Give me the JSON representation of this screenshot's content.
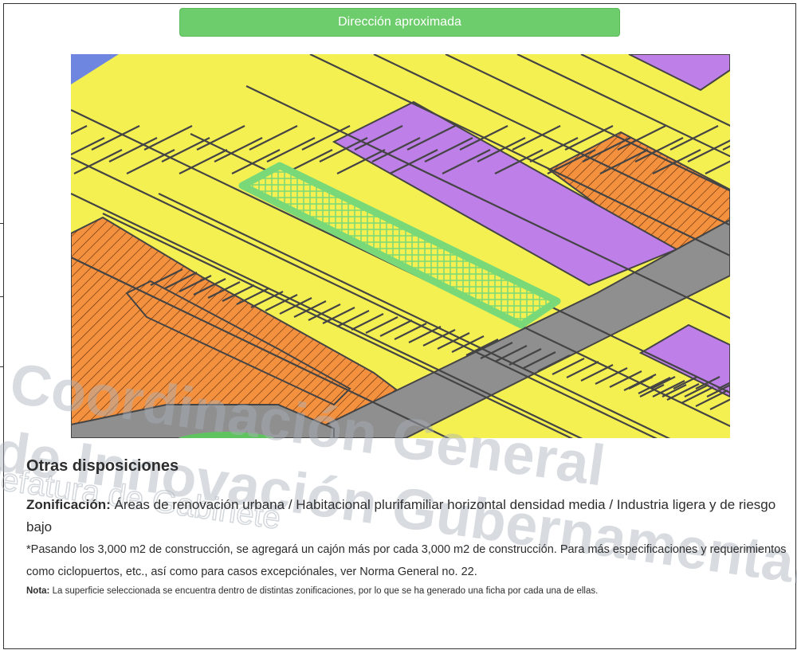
{
  "banner": {
    "label": "Dirección aproximada"
  },
  "map": {
    "colors": {
      "habitacional": "#f5f052",
      "equipamiento": "#be7fe8",
      "industria": "#f4913f",
      "vialidad": "#8f8f8f",
      "agua": "#6f86e0",
      "area_verde": "#5fc45f",
      "seleccion": "#79d978",
      "lineas": "#444444"
    }
  },
  "watermark": {
    "line1": "Coordinación General",
    "line2": "de Innovación Gubernamental",
    "line3": "Jefatura de Gabinete"
  },
  "otras": {
    "title": "Otras disposiciones",
    "zonificacion_label": "Zonificación:",
    "zonificacion_text": " Áreas de renovación urbana / Habitacional plurifamiliar horizontal densidad media / Industria ligera y de riesgo bajo",
    "asterisk_note": "*Pasando los 3,000 m2 de construcción, se agregará un cajón más por cada 3,000 m2 de construcción. Para más especificaciones y requerimientos como ciclopuertos, etc., así como para casos excepciónales, ver Norma General no. 22.",
    "nota_label": "Nota:",
    "nota_text": " La superficie seleccionada se encuentra dentro de distintas zonificaciones, por lo que se ha generado una ficha por cada una de ellas."
  }
}
